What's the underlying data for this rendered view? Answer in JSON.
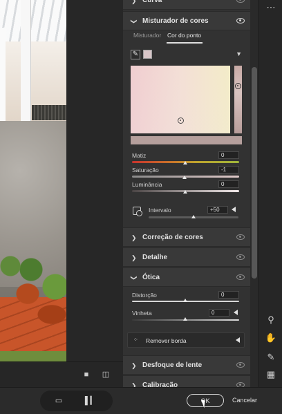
{
  "sections": {
    "curva": "Curva",
    "misturador": "Misturador de cores",
    "correcao": "Correção de cores",
    "detalhe": "Detalhe",
    "otica": "Ótica",
    "desfoque": "Desfoque de lente",
    "calibracao": "Calibração"
  },
  "mixer": {
    "tabs": [
      "Misturador",
      "Cor do ponto"
    ],
    "active_tab": "Cor do ponto",
    "matiz_label": "Matiz",
    "matiz_value": "0",
    "saturacao_label": "Saturação",
    "saturacao_value": "-1",
    "luminancia_label": "Luminância",
    "luminancia_value": "0",
    "intervalo_label": "Intervalo",
    "intervalo_value": "+50",
    "swatch_color": "#d8c6c8"
  },
  "otica": {
    "distorcao_label": "Distorção",
    "distorcao_value": "0",
    "vinheta_label": "Vinheta",
    "vinheta_value": "0",
    "remover_borda": "Remover borda"
  },
  "footer": {
    "ok": "OK",
    "cancel": "Cancelar"
  },
  "icons": [
    "eye-icon",
    "eyedropper-icon",
    "zoom-icon",
    "hand-icon",
    "sampler-icon",
    "grid-icon",
    "filmstrip-icon",
    "waveform-icon",
    "compare-icon",
    "more-icon"
  ]
}
